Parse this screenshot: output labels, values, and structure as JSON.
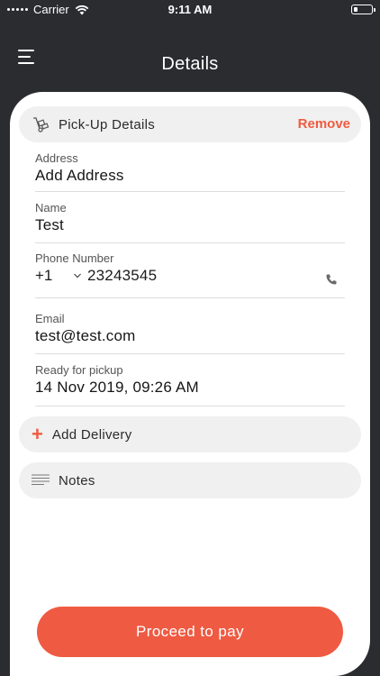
{
  "status_bar": {
    "carrier": "Carrier",
    "time": "9:11 AM"
  },
  "header": {
    "title": "Details",
    "menu_icon": "hamburger-menu-icon"
  },
  "pickup": {
    "label": "Pick-Up Details",
    "icon": "hand-truck-icon",
    "remove_label": "Remove",
    "fields": {
      "address": {
        "label": "Address",
        "value": "Add Address"
      },
      "name": {
        "label": "Name",
        "value": "Test"
      },
      "phone": {
        "label": "Phone Number",
        "country_code": "+1",
        "number": "23243545"
      },
      "email": {
        "label": "Email",
        "value": "test@test.com"
      },
      "ready": {
        "label": "Ready for pickup",
        "value": "14 Nov 2019, 09:26 AM"
      }
    }
  },
  "delivery": {
    "label": "Add Delivery",
    "icon_glyph": "+"
  },
  "notes": {
    "label": "Notes",
    "icon": "notes-lines-icon"
  },
  "proceed": {
    "label": "Proceed to pay"
  },
  "colors": {
    "accent": "#ef5a42",
    "background": "#2b2c30",
    "pill": "#f0f0f0"
  }
}
